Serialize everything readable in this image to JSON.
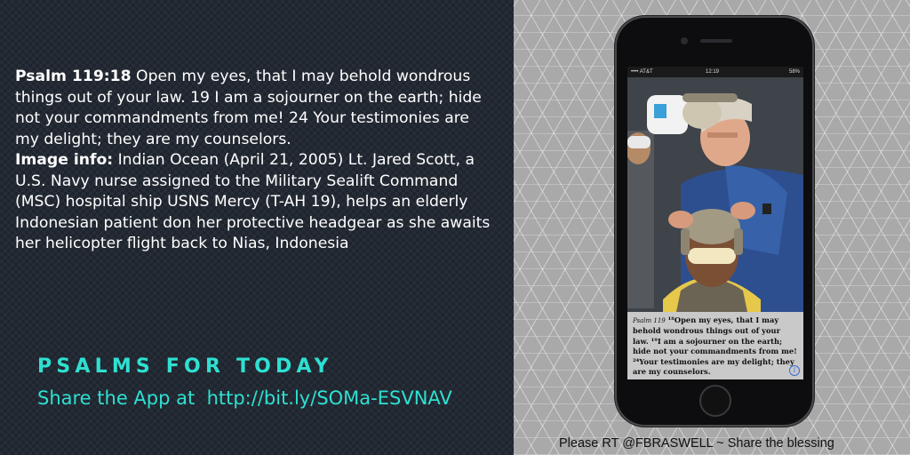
{
  "verse": {
    "reference": "Psalm 119:18",
    "text": " Open my eyes, that I may behold wondrous things out of your law. 19 I am a sojourner on the earth; hide not your commandments from me! 24 Your testimonies are my delight; they are my counselors.",
    "image_info_label": "Image info:",
    "image_info_text": " Indian Ocean (April 21, 2005) Lt. Jared Scott, a U.S. Navy nurse assigned to the Military Sealift Command (MSC) hospital ship USNS Mercy (T-AH 19), helps an elderly Indonesian patient don her protective headgear as she awaits her helicopter flight back to Nias, Indonesia"
  },
  "brand": {
    "title": "PSALMS FOR TODAY",
    "share": "Share the App at  http://bit.ly/SOMa-ESVNAV"
  },
  "credit": "Please RT @FBRASWELL ~ Share the blessing",
  "phone": {
    "status": {
      "carrier": "•••• AT&T",
      "clock": "12:19",
      "battery": "58%"
    },
    "caption": {
      "ref": "Psalm 119",
      "text": " ¹⁸Open my eyes, that I may behold wondrous things out of your law. ¹⁹I am a sojourner on the earth; hide not your commandments from me! ²⁴Your testimonies are my delight; they are my counselors."
    },
    "info_icon": "i"
  },
  "colors": {
    "accent": "#2ee0d2",
    "left_bg": "#1f252f",
    "right_bg": "#a9a9a9"
  },
  "icons": {
    "info": "info-icon",
    "home": "home-button"
  }
}
